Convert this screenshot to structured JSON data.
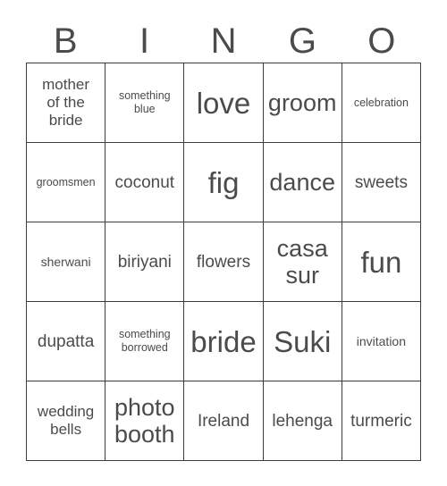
{
  "card": {
    "title": "BINGO",
    "header_letters": [
      "B",
      "I",
      "N",
      "G",
      "O"
    ],
    "text_color": "#4d4a4a",
    "border_color": "#3d3d3d",
    "background_color": "#ffffff",
    "columns": 5,
    "rows": 5,
    "cells": [
      {
        "text": "mother\nof the\nbride",
        "size": "m"
      },
      {
        "text": "something\nblue",
        "size": "xs"
      },
      {
        "text": "love",
        "size": "xxl"
      },
      {
        "text": "groom",
        "size": "xl"
      },
      {
        "text": "celebration",
        "size": "xs"
      },
      {
        "text": "groomsmen",
        "size": "xs"
      },
      {
        "text": "coconut",
        "size": "ml"
      },
      {
        "text": "fig",
        "size": "xxl"
      },
      {
        "text": "dance",
        "size": "xl"
      },
      {
        "text": "sweets",
        "size": "ml"
      },
      {
        "text": "sherwani",
        "size": "s"
      },
      {
        "text": "biriyani",
        "size": "ml"
      },
      {
        "text": "flowers",
        "size": "ml"
      },
      {
        "text": "casa\nsur",
        "size": "xl"
      },
      {
        "text": "fun",
        "size": "xxl"
      },
      {
        "text": "dupatta",
        "size": "ml"
      },
      {
        "text": "something\nborrowed",
        "size": "xs"
      },
      {
        "text": "bride",
        "size": "xxl"
      },
      {
        "text": "Suki",
        "size": "xxl"
      },
      {
        "text": "invitation",
        "size": "s"
      },
      {
        "text": "wedding\nbells",
        "size": "m"
      },
      {
        "text": "photo\nbooth",
        "size": "xl"
      },
      {
        "text": "Ireland",
        "size": "ml"
      },
      {
        "text": "lehenga",
        "size": "ml"
      },
      {
        "text": "turmeric",
        "size": "ml"
      }
    ]
  }
}
